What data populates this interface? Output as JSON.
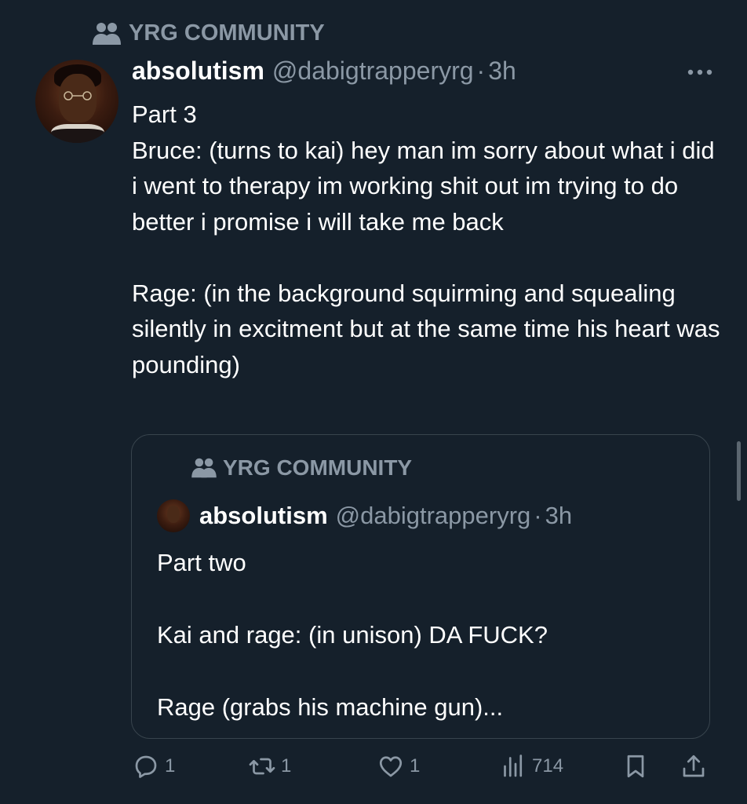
{
  "community": {
    "label": "YRG COMMUNITY",
    "icon": "community-icon"
  },
  "tweet": {
    "display_name": "absolutism",
    "handle": "@dabigtrapperyrg",
    "separator": "·",
    "time": "3h",
    "text": "Part 3\nBruce: (turns to kai) hey man im sorry about what i did i went to therapy im working shit out im trying to do better i promise i will take me back\n\nRage: (in the background squirming and squealing silently in excitment but at the same time his heart was pounding)"
  },
  "quote": {
    "community": "YRG COMMUNITY",
    "display_name": "absolutism",
    "handle": "@dabigtrapperyrg",
    "separator": "·",
    "time": "3h",
    "text": "Part two\n\nKai and rage: (in unison) DA FUCK?\n\nRage (grabs his machine gun)..."
  },
  "actions": {
    "replies": "1",
    "reposts": "1",
    "likes": "1",
    "views": "714"
  },
  "colors": {
    "background": "#15202b",
    "secondary_text": "#8b98a5",
    "border": "#38444d"
  }
}
